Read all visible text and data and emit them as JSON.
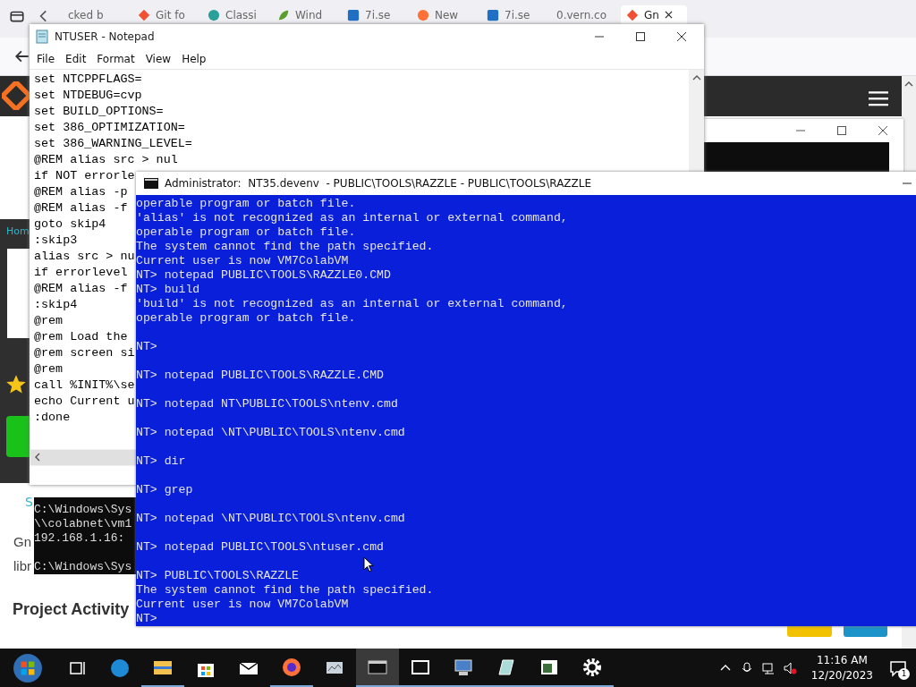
{
  "browser": {
    "tabs": [
      {
        "label": "cked b",
        "selected": false
      },
      {
        "label": "Git fo",
        "selected": false
      },
      {
        "label": "Classi",
        "selected": false
      },
      {
        "label": "Wind",
        "selected": false
      },
      {
        "label": "7i.se",
        "selected": false
      },
      {
        "label": "New",
        "selected": false
      },
      {
        "label": "7i.se",
        "selected": false
      },
      {
        "label": "0.vern.co",
        "selected": false
      },
      {
        "label": "Gn",
        "selected": true
      }
    ],
    "page": {
      "nav_link": "Hom",
      "link": "S",
      "text_lines": [
        "Gn",
        "libr"
      ],
      "heading": "Project Activity"
    }
  },
  "small_console": {
    "lines": [
      {
        "text": "C:\\Windows\\Sys",
        "blank_before": false
      },
      {
        "text": "\\\\colabnet\\vm1",
        "blank_before": false
      },
      {
        "text": "192.168.1.16:",
        "blank_before": false
      },
      {
        "text": "C:\\Windows\\Sys",
        "blank_before": true
      }
    ]
  },
  "notepad": {
    "title": "NTUSER - Notepad",
    "menu": [
      "File",
      "Edit",
      "Format",
      "View",
      "Help"
    ],
    "lines": [
      "set NTCPPFLAGS=",
      "set NTDEBUG=cvp",
      "set BUILD_OPTIONS=",
      "set 386_OPTIMIZATION=",
      "set 386_WARNING_LEVEL=",
      "@REM alias src > nul",
      "if NOT errorle",
      "@REM alias -p",
      "@REM alias -f",
      "goto skip4",
      ":skip3",
      "alias src > nu",
      "if errorlevel",
      "@REM alias -f",
      ":skip4",
      "@rem",
      "@rem Load the",
      "@rem screen si",
      "@rem",
      "call %INIT%\\se",
      "echo Current u",
      ":done"
    ]
  },
  "console": {
    "title": "Administrator:  NT35.devenv  - PUBLIC\\TOOLS\\RAZZLE - PUBLIC\\TOOLS\\RAZZLE",
    "lines": [
      {
        "text": "operable program or batch file.",
        "blank_before": false
      },
      {
        "text": "'alias' is not recognized as an internal or external command,",
        "blank_before": false
      },
      {
        "text": "operable program or batch file.",
        "blank_before": false
      },
      {
        "text": "The system cannot find the path specified.",
        "blank_before": false
      },
      {
        "text": "Current user is now VM7ColabVM",
        "blank_before": false
      },
      {
        "text": "NT> notepad PUBLIC\\TOOLS\\RAZZLE0.CMD",
        "blank_before": false
      },
      {
        "text": "NT> build",
        "blank_before": false
      },
      {
        "text": "'build' is not recognized as an internal or external command,",
        "blank_before": false
      },
      {
        "text": "operable program or batch file.",
        "blank_before": false
      },
      {
        "text": "NT>",
        "blank_before": true
      },
      {
        "text": "NT> notepad PUBLIC\\TOOLS\\RAZZLE.CMD",
        "blank_before": true
      },
      {
        "text": "NT> notepad NT\\PUBLIC\\TOOLS\\ntenv.cmd",
        "blank_before": true
      },
      {
        "text": "NT> notepad \\NT\\PUBLIC\\TOOLS\\ntenv.cmd",
        "blank_before": true
      },
      {
        "text": "NT> dir",
        "blank_before": true
      },
      {
        "text": "NT> grep",
        "blank_before": true
      },
      {
        "text": "NT> notepad \\NT\\PUBLIC\\TOOLS\\ntenv.cmd",
        "blank_before": true
      },
      {
        "text": "NT> notepad PUBLIC\\TOOLS\\ntuser.cmd",
        "blank_before": true
      },
      {
        "text": "NT> PUBLIC\\TOOLS\\RAZZLE",
        "blank_before": true
      },
      {
        "text": "The system cannot find the path specified.",
        "blank_before": false
      },
      {
        "text": "Current user is now VM7ColabVM",
        "blank_before": false
      },
      {
        "text": "NT>",
        "blank_before": false
      }
    ]
  },
  "taskbar": {
    "apps": [
      {
        "kind": "taskview",
        "running": false,
        "selected": false
      },
      {
        "kind": "edge",
        "running": false,
        "selected": false
      },
      {
        "kind": "folder",
        "running": true,
        "selected": false
      },
      {
        "kind": "store",
        "running": false,
        "selected": false
      },
      {
        "kind": "mail",
        "running": false,
        "selected": false
      },
      {
        "kind": "firefox",
        "running": true,
        "selected": false
      },
      {
        "kind": "monitor",
        "running": false,
        "selected": false
      },
      {
        "kind": "terminal",
        "running": true,
        "selected": true
      },
      {
        "kind": "archive",
        "running": true,
        "selected": false
      },
      {
        "kind": "computer",
        "running": true,
        "selected": false
      },
      {
        "kind": "notepad",
        "running": true,
        "selected": false
      },
      {
        "kind": "window",
        "running": true,
        "selected": false
      },
      {
        "kind": "gear",
        "running": true,
        "selected": false
      }
    ],
    "time": "11:16 AM",
    "date": "12/20/2023",
    "notifications": "1"
  }
}
